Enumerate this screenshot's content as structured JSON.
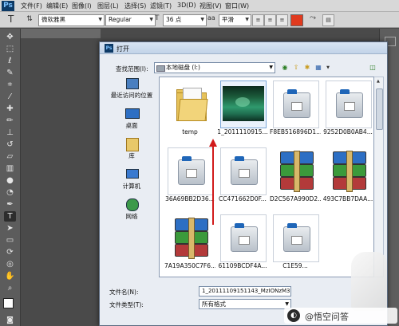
{
  "menubar": {
    "app_logo": "Ps",
    "items": [
      "文件(F)",
      "编辑(E)",
      "图像(I)",
      "图层(L)",
      "选择(S)",
      "滤镜(T)",
      "3D(D)",
      "视图(V)",
      "窗口(W)"
    ]
  },
  "options_bar": {
    "tool_glyph": "T",
    "font_family": "微软雅黑",
    "font_style": "Regular",
    "font_size": "36 点",
    "antialias": "平滑",
    "text_color": "#e03a1e"
  },
  "dialog": {
    "title": "打开",
    "look_in_label": "查找范围(I):",
    "look_in_value": "本地磁盘 (I:)",
    "places": [
      {
        "label": "最近访问的位置",
        "icon": "recent-places-icon"
      },
      {
        "label": "桌面",
        "icon": "desktop-icon"
      },
      {
        "label": "库",
        "icon": "library-icon"
      },
      {
        "label": "计算机",
        "icon": "computer-icon"
      },
      {
        "label": "网络",
        "icon": "network-icon"
      }
    ],
    "files": [
      {
        "name": "temp",
        "type": "folder"
      },
      {
        "name": "1_2011110915...",
        "type": "photo"
      },
      {
        "name": "F8EB516896D1...",
        "type": "package"
      },
      {
        "name": "9252D0B0AB4...",
        "type": "package"
      },
      {
        "name": "36A69BB2D36...",
        "type": "package"
      },
      {
        "name": "CC471662D0F...",
        "type": "package"
      },
      {
        "name": "D2C567A990D2...",
        "type": "archive"
      },
      {
        "name": "493C7BB7DAA...",
        "type": "archive"
      },
      {
        "name": "7A19A350C7F6...",
        "type": "archive"
      },
      {
        "name": "61109BCDF4A...",
        "type": "package"
      },
      {
        "name": "C1E59...",
        "type": "package"
      }
    ],
    "filename_label": "文件名(N):",
    "filename_value": "1_20111109151143_MzIONzM3N",
    "filetype_label": "文件类型(T):",
    "filetype_value": "所有格式"
  },
  "watermark": {
    "text": "@悟空问答"
  }
}
